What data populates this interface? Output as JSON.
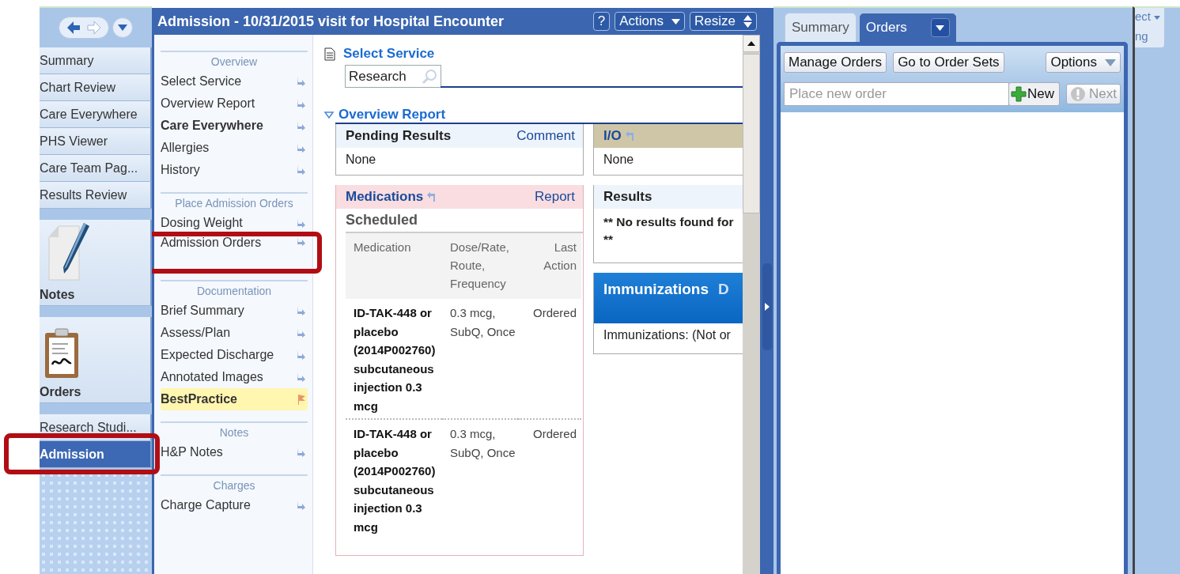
{
  "sidebar": {
    "items": [
      {
        "label": "Summary",
        "kind": "tab",
        "selected": false,
        "highlighted": false
      },
      {
        "label": "Chart Review",
        "kind": "tab",
        "selected": false,
        "highlighted": false
      },
      {
        "label": "Care Everywhere",
        "kind": "tab",
        "selected": false,
        "highlighted": false
      },
      {
        "label": "PHS Viewer",
        "kind": "tab",
        "selected": false,
        "highlighted": false
      },
      {
        "label": "Care Team Pag...",
        "kind": "tab",
        "selected": false,
        "highlighted": false
      },
      {
        "label": "Results Review",
        "kind": "tab",
        "selected": false,
        "highlighted": false
      },
      {
        "label": "Notes",
        "kind": "tile",
        "selected": false,
        "highlighted": false
      },
      {
        "label": "Orders",
        "kind": "tile",
        "selected": false,
        "highlighted": false
      },
      {
        "label": "Research Studi...",
        "kind": "tab",
        "selected": false,
        "highlighted": false
      },
      {
        "label": "Admission",
        "kind": "tab",
        "selected": true,
        "highlighted": true
      }
    ]
  },
  "window": {
    "title": "Admission - 10/31/2015 visit for Hospital Encounter",
    "buttons": [
      {
        "label": "?",
        "kind": "plain"
      },
      {
        "label": "Actions",
        "kind": "menu"
      },
      {
        "label": "Resize",
        "kind": "spinner"
      }
    ]
  },
  "navigator": {
    "sections": [
      {
        "title": "Overview",
        "items": [
          {
            "label": "Select Service",
            "kind": "link",
            "bold": false,
            "highlighted": false
          },
          {
            "label": "Overview Report",
            "kind": "link",
            "bold": false,
            "highlighted": false
          },
          {
            "label": "Care Everywhere",
            "kind": "link",
            "bold": true,
            "highlighted": false
          },
          {
            "label": "Allergies",
            "kind": "link",
            "bold": false,
            "highlighted": false
          },
          {
            "label": "History",
            "kind": "link",
            "bold": false,
            "highlighted": false
          }
        ]
      },
      {
        "title": "Place Admission Orders",
        "items": [
          {
            "label": "Dosing Weight",
            "kind": "link",
            "bold": false,
            "highlighted": false
          },
          {
            "label": "Admission Orders",
            "kind": "link",
            "bold": false,
            "highlighted": true
          }
        ]
      },
      {
        "title": "Documentation",
        "items": [
          {
            "label": "Brief Summary",
            "kind": "link",
            "bold": false,
            "highlighted": false
          },
          {
            "label": "Assess/Plan",
            "kind": "link",
            "bold": false,
            "highlighted": false
          },
          {
            "label": "Expected Discharge",
            "kind": "link",
            "bold": false,
            "highlighted": false
          },
          {
            "label": "Annotated Images",
            "kind": "link",
            "bold": false,
            "highlighted": false
          },
          {
            "label": "BestPractice",
            "kind": "alert",
            "bold": true,
            "highlighted": false
          }
        ]
      },
      {
        "title": "Notes",
        "items": [
          {
            "label": "H&P Notes",
            "kind": "link",
            "bold": false,
            "highlighted": false
          }
        ]
      },
      {
        "title": "Charges",
        "items": [
          {
            "label": "Charge Capture",
            "kind": "link",
            "bold": false,
            "highlighted": false
          }
        ]
      }
    ]
  },
  "select_service": {
    "title": "Select Service",
    "value": "Research"
  },
  "overview_report": {
    "title": "Overview Report",
    "expanded": true
  },
  "pending_results": {
    "title": "Pending Results",
    "link": "Comment",
    "body": "None"
  },
  "io": {
    "title": "I/O",
    "body": "None"
  },
  "medications": {
    "title": "Medications",
    "link": "Report",
    "group": "Scheduled",
    "columns": [
      "Medication",
      "Dose/Rate, Route, Frequency",
      "Last Action"
    ],
    "rows": [
      [
        "ID-TAK-448 or placebo (2014P002760) subcutaneous injection 0.3 mcg",
        "0.3 mcg, SubQ, Once",
        "Ordered"
      ],
      [
        "ID-TAK-448 or placebo (2014P002760) subcutaneous injection 0.3 mcg",
        "0.3 mcg, SubQ, Once",
        "Ordered"
      ]
    ]
  },
  "results": {
    "title": "Results",
    "lines": [
      "** No results found for",
      "**"
    ]
  },
  "immunizations": {
    "title": "Immunizations",
    "link": "D",
    "body": "Immunizations: (Not or"
  },
  "orders_panel": {
    "tabs": [
      {
        "label": "Summary",
        "selected": false
      },
      {
        "label": "Orders",
        "selected": true
      }
    ],
    "buttons": [
      "Manage Orders",
      "Go to Order Sets"
    ],
    "options": "Options",
    "order_field": {
      "placeholder": "Place new order"
    },
    "new_button": {
      "label": "New",
      "disabled": false
    },
    "next_button": {
      "label": "Next",
      "disabled": true
    }
  },
  "ribbon_fragments": [
    "ect",
    "ng"
  ]
}
